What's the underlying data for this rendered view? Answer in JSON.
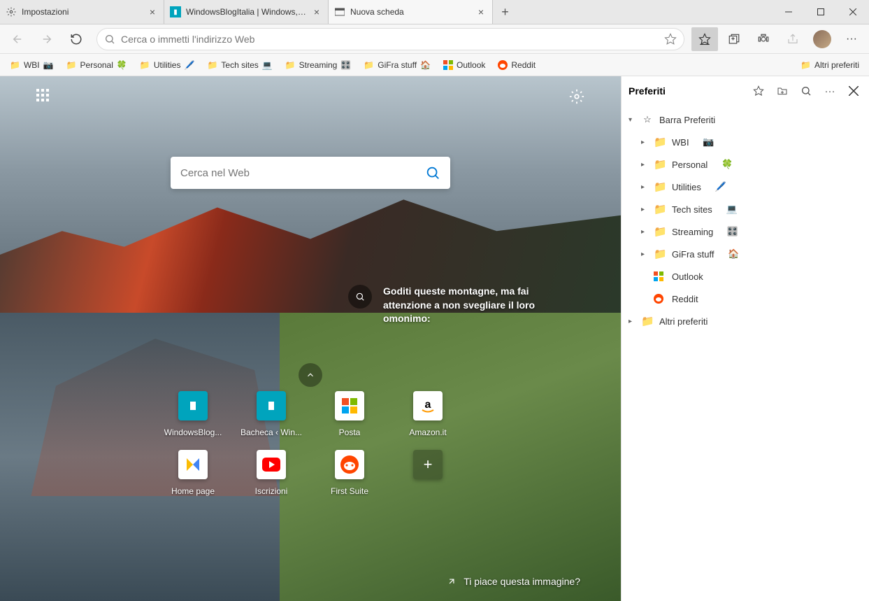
{
  "tabs": [
    {
      "title": "Impostazioni",
      "icon": "gear"
    },
    {
      "title": "WindowsBlogItalia | Windows, S...",
      "icon": "wbi"
    },
    {
      "title": "Nuova scheda",
      "icon": "ntp",
      "active": true
    }
  ],
  "address": {
    "placeholder": "Cerca o immetti l'indirizzo Web"
  },
  "bookmarks_bar": {
    "items": [
      {
        "label": "WBI",
        "emoji": "📷",
        "folder": true
      },
      {
        "label": "Personal",
        "emoji": "🍀",
        "folder": true
      },
      {
        "label": "Utilities",
        "emoji": "🖊️",
        "folder": true
      },
      {
        "label": "Tech sites",
        "emoji": "💻",
        "folder": true
      },
      {
        "label": "Streaming",
        "emoji": "🎛️",
        "folder": true
      },
      {
        "label": "GiFra stuff",
        "emoji": "🏠",
        "folder": true
      },
      {
        "label": "Outlook",
        "icon": "ms"
      },
      {
        "label": "Reddit",
        "icon": "reddit"
      }
    ],
    "overflow": "Altri preferiti"
  },
  "ntp": {
    "search_placeholder": "Cerca nel Web",
    "info_text": "Goditi queste montagne, ma fai attenzione a non svegliare il loro omonimo:",
    "tiles": [
      {
        "label": "WindowsBlog...",
        "color": "#00a4bd"
      },
      {
        "label": "Bacheca ‹ Win...",
        "color": "#00a4bd"
      },
      {
        "label": "Posta",
        "icon": "ms"
      },
      {
        "label": "Amazon.it",
        "icon": "amazon"
      },
      {
        "label": "Home page",
        "icon": "adsense"
      },
      {
        "label": "Iscrizioni",
        "icon": "youtube"
      },
      {
        "label": "First Suite",
        "icon": "reddit"
      }
    ],
    "like_text": "Ti piace questa immagine?"
  },
  "fav_panel": {
    "title": "Preferiti",
    "root": "Barra Preferiti",
    "items": [
      {
        "label": "WBI",
        "emoji": "📷"
      },
      {
        "label": "Personal",
        "emoji": "🍀"
      },
      {
        "label": "Utilities",
        "emoji": "🖊️"
      },
      {
        "label": "Tech sites",
        "emoji": "💻"
      },
      {
        "label": "Streaming",
        "emoji": "🎛️"
      },
      {
        "label": "GiFra stuff",
        "emoji": "🏠"
      },
      {
        "label": "Outlook",
        "icon": "ms",
        "leaf": true
      },
      {
        "label": "Reddit",
        "icon": "reddit",
        "leaf": true
      }
    ],
    "other": "Altri preferiti"
  }
}
